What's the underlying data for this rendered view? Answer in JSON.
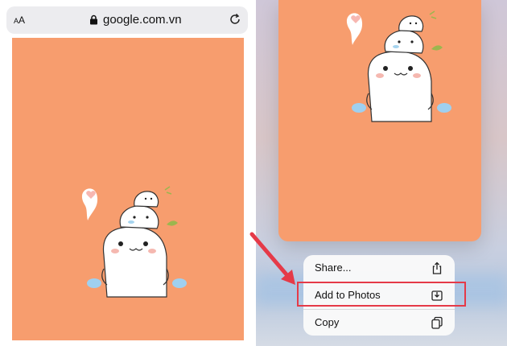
{
  "browser": {
    "text_size_button": "AA",
    "url": "google.com.vn",
    "icons": [
      "text-size-icon",
      "lock-icon",
      "reload-icon"
    ]
  },
  "context_menu": {
    "items": [
      {
        "label": "Share...",
        "icon": "share-icon"
      },
      {
        "label": "Add to Photos",
        "icon": "add-to-photos-icon"
      },
      {
        "label": "Copy",
        "icon": "copy-icon"
      }
    ],
    "highlighted": "Add to Photos"
  },
  "colors": {
    "background": "#f79d6e",
    "highlight": "#e53a48",
    "address_bar": "#ececef"
  }
}
